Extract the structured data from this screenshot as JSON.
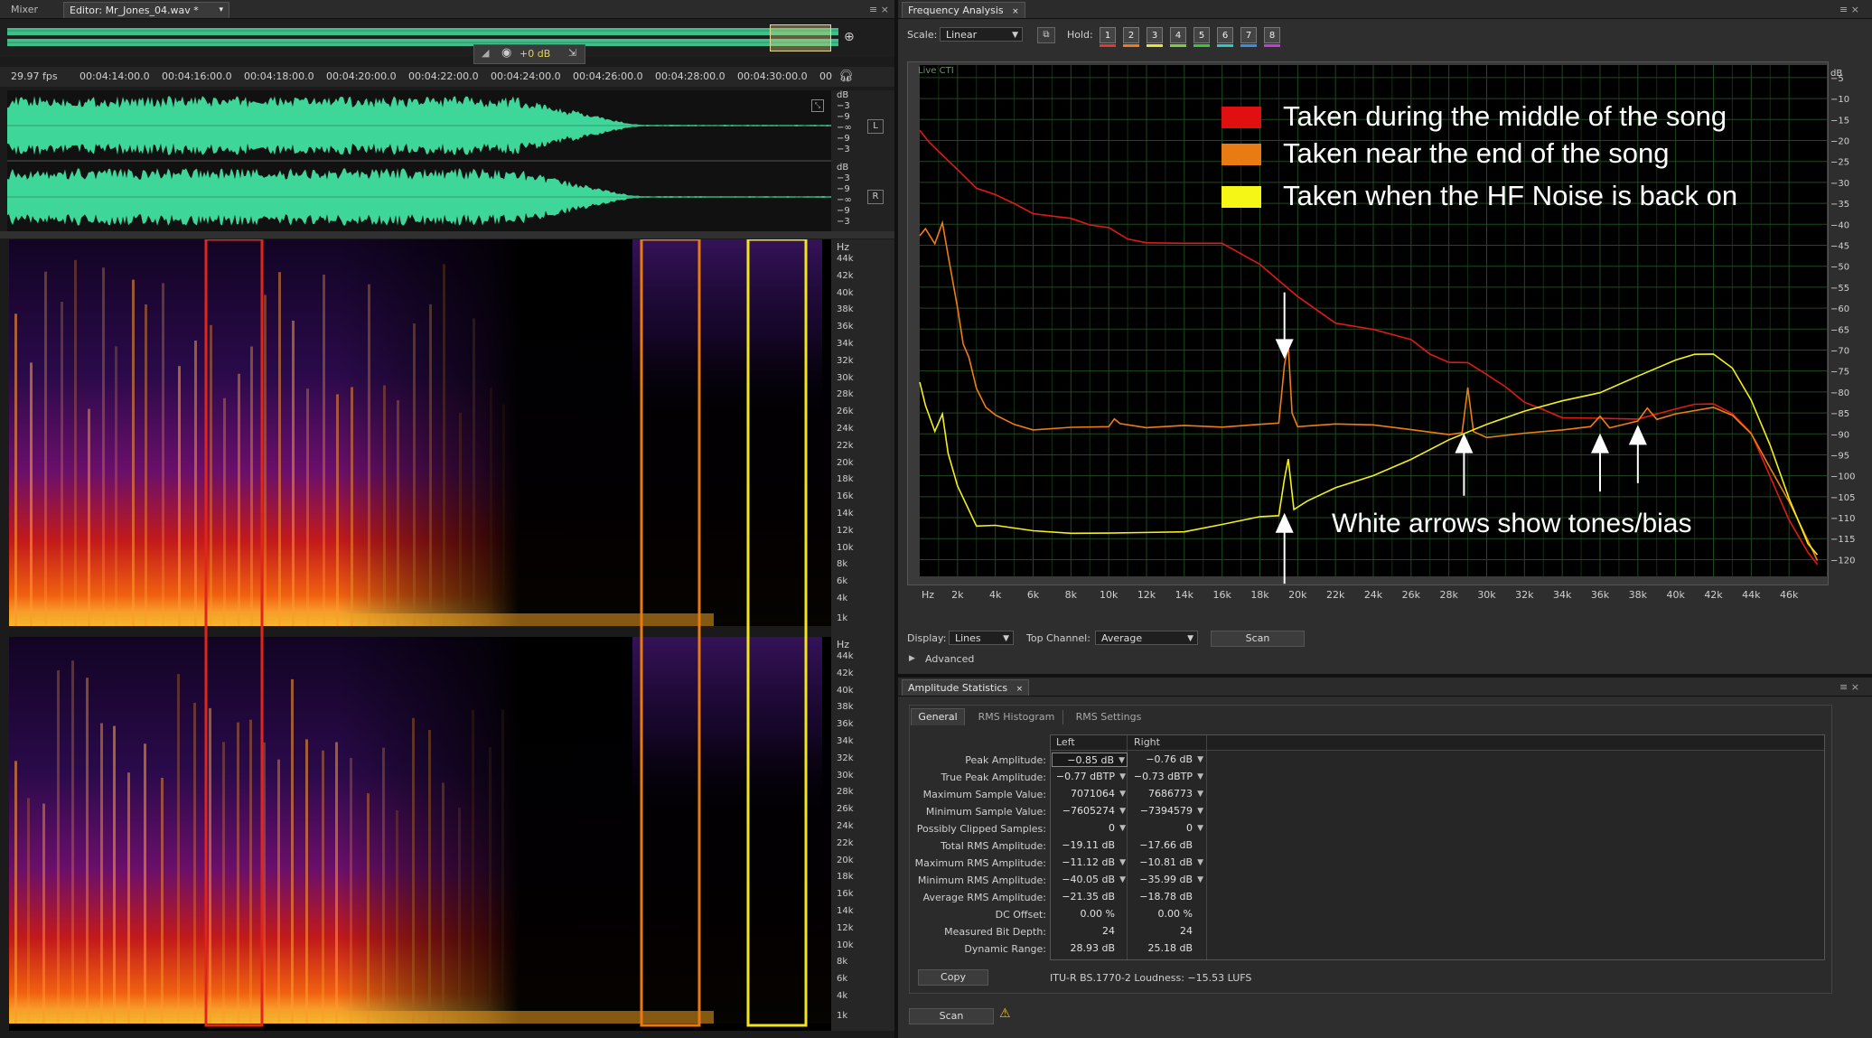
{
  "left_tabs": {
    "mixer": "Mixer",
    "editor": "Editor: Mr_Jones_04.wav *"
  },
  "overview": {
    "gain": "+0 dB"
  },
  "timeline": {
    "fps": "29.97 fps",
    "ticks": [
      "00:04:14:00.0",
      "00:04:16:00.0",
      "00:04:18:00.0",
      "00:04:20:00.0",
      "00:04:22:00.0",
      "00:04:24:00.0",
      "00:04:26:00.0",
      "00:04:28:00.0",
      "00:04:30:00.0",
      "00"
    ]
  },
  "channels": {
    "left": "L",
    "right": "R"
  },
  "db_ruler": [
    "dB",
    "−3",
    "−9",
    "−∞",
    "−9",
    "−3"
  ],
  "spectrogram": {
    "hz_label": "Hz",
    "ticks": [
      "44k",
      "42k",
      "40k",
      "38k",
      "36k",
      "34k",
      "32k",
      "30k",
      "28k",
      "26k",
      "24k",
      "22k",
      "20k",
      "18k",
      "16k",
      "14k",
      "12k",
      "10k",
      "8k",
      "6k",
      "4k",
      "1k"
    ],
    "highlight_colors": {
      "middle": "#e0261c",
      "end": "#e87a12",
      "hf": "#f0e61a"
    }
  },
  "frequency_analysis": {
    "tab": "Frequency Analysis",
    "scale_label": "Scale:",
    "scale_value": "Linear",
    "hold_label": "Hold:",
    "holds": [
      {
        "n": "1",
        "color": "#e23a2e"
      },
      {
        "n": "2",
        "color": "#ee7d1a"
      },
      {
        "n": "3",
        "color": "#e8e23a"
      },
      {
        "n": "4",
        "color": "#7dd23a"
      },
      {
        "n": "5",
        "color": "#3ac83a"
      },
      {
        "n": "6",
        "color": "#2ec8c8"
      },
      {
        "n": "7",
        "color": "#3a8ee8"
      },
      {
        "n": "8",
        "color": "#c83ae0"
      }
    ],
    "live_label": "Live CTI",
    "display_label": "Display:",
    "display_value": "Lines",
    "top_channel_label": "Top Channel:",
    "top_channel_value": "Average",
    "scan": "Scan",
    "advanced": "Advanced"
  },
  "chart_data": {
    "type": "line",
    "xlabel": "Hz",
    "ylabel": "dB",
    "xlim": [
      0,
      48000
    ],
    "ylim": [
      -124,
      -2
    ],
    "x_ticks": [
      "Hz",
      "2k",
      "4k",
      "6k",
      "8k",
      "10k",
      "12k",
      "14k",
      "16k",
      "18k",
      "20k",
      "22k",
      "24k",
      "26k",
      "28k",
      "30k",
      "32k",
      "34k",
      "36k",
      "38k",
      "40k",
      "42k",
      "44k",
      "46k"
    ],
    "y_ticks": [
      "dB",
      "−5",
      "−10",
      "−15",
      "−20",
      "−25",
      "−30",
      "−35",
      "−40",
      "−45",
      "−50",
      "−55",
      "−60",
      "−65",
      "−70",
      "−75",
      "−80",
      "−85",
      "−90",
      "−95",
      "−100",
      "−105",
      "−110",
      "−115",
      "−120"
    ],
    "grid": true,
    "series": [
      {
        "name": "Taken during the middle of the song",
        "color": "#e01a14",
        "x": [
          0,
          500,
          1000,
          2000,
          3000,
          4000,
          5000,
          6000,
          7000,
          8000,
          9000,
          10000,
          11000,
          12000,
          14000,
          16000,
          18000,
          19000,
          20000,
          22000,
          24000,
          26000,
          27000,
          28000,
          29000,
          30000,
          31000,
          32000,
          33000,
          34000,
          36000,
          38000,
          40000,
          41000,
          42000,
          43000,
          44000,
          45000,
          46000,
          47000,
          47500
        ],
        "y": [
          -17,
          -20,
          -23,
          -27,
          -31,
          -33,
          -35,
          -37,
          -38,
          -38,
          -40,
          -41,
          -43,
          -44,
          -44,
          -45,
          -49,
          -54,
          -57,
          -63,
          -65,
          -68,
          -71,
          -73,
          -73,
          -76,
          -79,
          -82,
          -84,
          -86,
          -86,
          -86,
          -84,
          -83,
          -83,
          -85,
          -90,
          -100,
          -110,
          -118,
          -121
        ]
      },
      {
        "name": "Taken near the end of the song",
        "color": "#f07d12",
        "x": [
          0,
          300,
          800,
          1200,
          1500,
          2000,
          2300,
          2600,
          3000,
          3500,
          4000,
          5000,
          6000,
          8000,
          10000,
          10300,
          10600,
          12000,
          14000,
          16000,
          18000,
          19000,
          19300,
          19500,
          19700,
          20000,
          22000,
          24000,
          26000,
          28000,
          28700,
          29000,
          29300,
          30000,
          32000,
          34000,
          35500,
          36000,
          36500,
          38000,
          38500,
          39000,
          40000,
          42000,
          43000,
          44000,
          45000,
          46000,
          47000,
          47500
        ],
        "y": [
          -43,
          -41,
          -45,
          -40,
          -47,
          -60,
          -68,
          -72,
          -79,
          -84,
          -86,
          -88,
          -89,
          -89,
          -88,
          -86,
          -88,
          -89,
          -88,
          -88,
          -88,
          -88,
          -73,
          -69,
          -85,
          -88,
          -88,
          -88,
          -89,
          -90,
          -90,
          -79,
          -90,
          -91,
          -90,
          -89,
          -88,
          -86,
          -88,
          -87,
          -84,
          -87,
          -85,
          -84,
          -86,
          -90,
          -98,
          -106,
          -115,
          -120
        ]
      },
      {
        "name": "Taken when the HF Noise is back on",
        "color": "#f5f01a",
        "x": [
          0,
          300,
          800,
          1200,
          1500,
          2000,
          3000,
          4000,
          6000,
          8000,
          10000,
          14000,
          16000,
          18000,
          19000,
          19300,
          19500,
          19800,
          20500,
          22000,
          24000,
          26000,
          28000,
          30000,
          32000,
          34000,
          36000,
          38000,
          40000,
          41000,
          42000,
          43000,
          44000,
          45000,
          46000,
          47000,
          47500
        ],
        "y": [
          -78,
          -83,
          -89,
          -85,
          -95,
          -102,
          -112,
          -112,
          -113,
          -114,
          -114,
          -113,
          -112,
          -110,
          -110,
          -101,
          -96,
          -108,
          -106,
          -103,
          -100,
          -96,
          -92,
          -88,
          -85,
          -82,
          -80,
          -76,
          -72,
          -71,
          -71,
          -74,
          -82,
          -93,
          -105,
          -116,
          -119
        ]
      }
    ],
    "legend": [
      {
        "label": "Taken during the middle of the song",
        "color": "#e01010"
      },
      {
        "label": "Taken near the end of the song",
        "color": "#e87c12"
      },
      {
        "label": "Taken when the HF Noise is back on",
        "color": "#f5f516"
      }
    ],
    "annotation": "White arrows show tones/bias"
  },
  "amplitude_statistics": {
    "tab": "Amplitude Statistics",
    "subtabs": [
      "General",
      "RMS Histogram",
      "RMS Settings"
    ],
    "headers": [
      "Left",
      "Right"
    ],
    "rows": [
      {
        "label": "Peak Amplitude:",
        "left": "−0.85 dB",
        "right": "−0.76 dB",
        "pin": true
      },
      {
        "label": "True Peak Amplitude:",
        "left": "−0.77 dBTP",
        "right": "−0.73 dBTP",
        "pin": true
      },
      {
        "label": "Maximum Sample Value:",
        "left": "7071064",
        "right": "7686773",
        "pin": true
      },
      {
        "label": "Minimum Sample Value:",
        "left": "−7605274",
        "right": "−7394579",
        "pin": true
      },
      {
        "label": "Possibly Clipped Samples:",
        "left": "0",
        "right": "0",
        "pin": true
      },
      {
        "label": "Total RMS Amplitude:",
        "left": "−19.11 dB",
        "right": "−17.66 dB",
        "pin": false
      },
      {
        "label": "Maximum RMS Amplitude:",
        "left": "−11.12 dB",
        "right": "−10.81 dB",
        "pin": true
      },
      {
        "label": "Minimum RMS Amplitude:",
        "left": "−40.05 dB",
        "right": "−35.99 dB",
        "pin": true
      },
      {
        "label": "Average RMS Amplitude:",
        "left": "−21.35 dB",
        "right": "−18.78 dB",
        "pin": false
      },
      {
        "label": "DC Offset:",
        "left": "0.00 %",
        "right": "0.00 %",
        "pin": false
      },
      {
        "label": "Measured Bit Depth:",
        "left": "24",
        "right": "24",
        "pin": false
      },
      {
        "label": "Dynamic Range:",
        "left": "28.93 dB",
        "right": "25.18 dB",
        "pin": false
      }
    ],
    "copy": "Copy",
    "loudness": "ITU-R BS.1770-2 Loudness: −15.53 LUFS",
    "scan": "Scan"
  }
}
